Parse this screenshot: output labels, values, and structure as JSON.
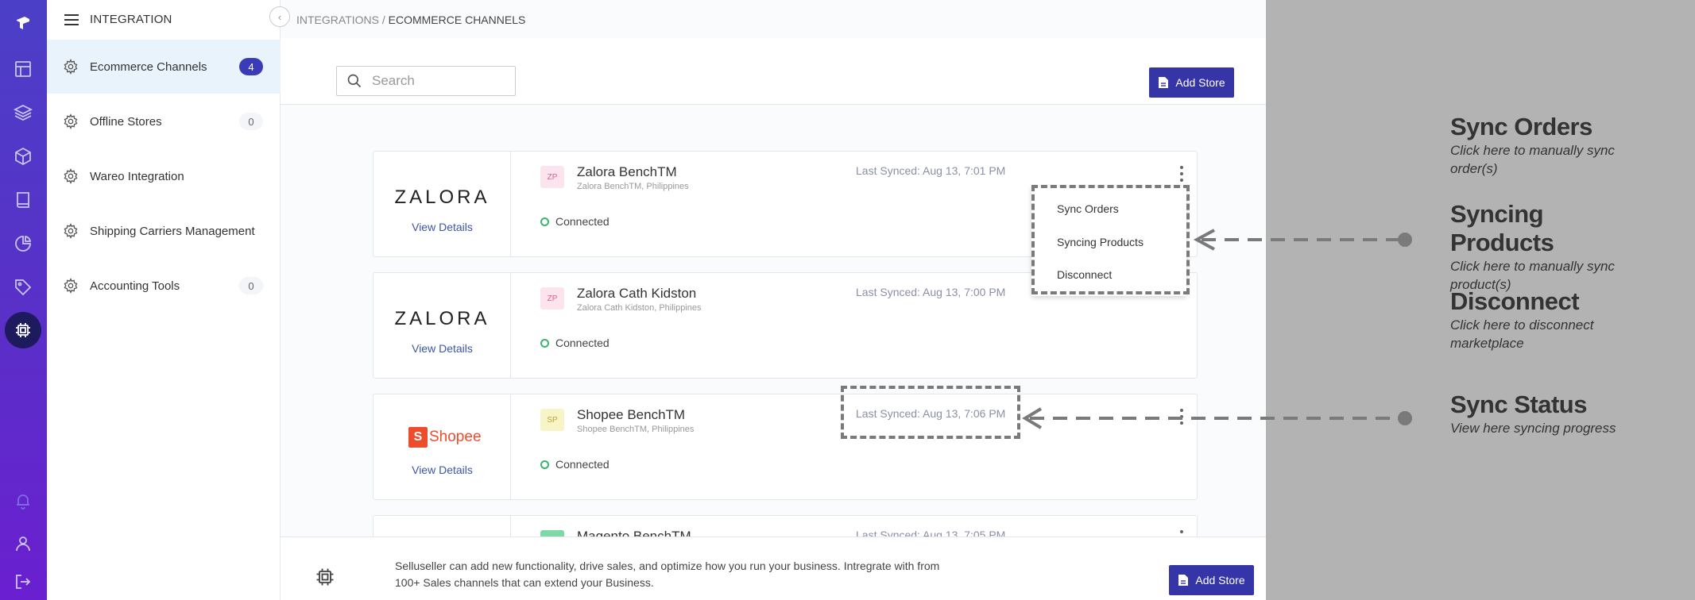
{
  "sidebar": {
    "title": "INTEGRATION",
    "items": [
      {
        "label": "Ecommerce Channels",
        "count": "4"
      },
      {
        "label": "Offline Stores",
        "count": "0"
      },
      {
        "label": "Wareo Integration",
        "count": ""
      },
      {
        "label": "Shipping Carriers Management",
        "count": ""
      },
      {
        "label": "Accounting Tools",
        "count": "0"
      }
    ]
  },
  "breadcrumb": {
    "parent": "INTEGRATIONS /",
    "current": "ECOMMERCE CHANNELS"
  },
  "search": {
    "placeholder": "Search"
  },
  "toolbar": {
    "add_store_label": "Add Store"
  },
  "stores": [
    {
      "logo": "ZALORA",
      "view": "View Details",
      "badge": "ZP",
      "name": "Zalora BenchTM",
      "sub": "Zalora BenchTM, Philippines",
      "status": "Connected",
      "synced": "Last Synced: Aug 13, 7:01 PM"
    },
    {
      "logo": "ZALORA",
      "view": "View Details",
      "badge": "ZP",
      "name": "Zalora Cath Kidston",
      "sub": "Zalora Cath Kidston, Philippines",
      "status": "Connected",
      "synced": "Last Synced: Aug 13, 7:00 PM"
    },
    {
      "logo": "Shopee",
      "view": "View Details",
      "badge": "SP",
      "name": "Shopee BenchTM",
      "sub": "Shopee BenchTM, Philippines",
      "status": "Connected",
      "synced": "Last Synced: Aug 13, 7:06 PM"
    },
    {
      "name": "Magento BenchTM",
      "synced": "Last Synced: Aug 13, 7:05 PM"
    }
  ],
  "menu": [
    "Sync Orders",
    "Syncing Products",
    "Disconnect"
  ],
  "footer": {
    "text": "Selluseller can add new functionality, drive sales, and optimize how you run your business. Intregrate with from 100+ Sales channels that can extend your Business.",
    "add_store_label": "Add Store"
  },
  "annotations": [
    {
      "title": "Sync Orders",
      "desc": "Click here to manually sync order(s)"
    },
    {
      "title": "Syncing Products",
      "desc": "Click here to manually sync product(s)"
    },
    {
      "title": "Disconnect",
      "desc": "Click here to disconnect marketplace"
    },
    {
      "title": "Sync Status",
      "desc": "View here syncing progress"
    }
  ],
  "colors": {
    "brand": "#3535a8",
    "rail": "#5a2fc8",
    "connected": "#3cb371",
    "overlay": "#b3b3b3"
  }
}
